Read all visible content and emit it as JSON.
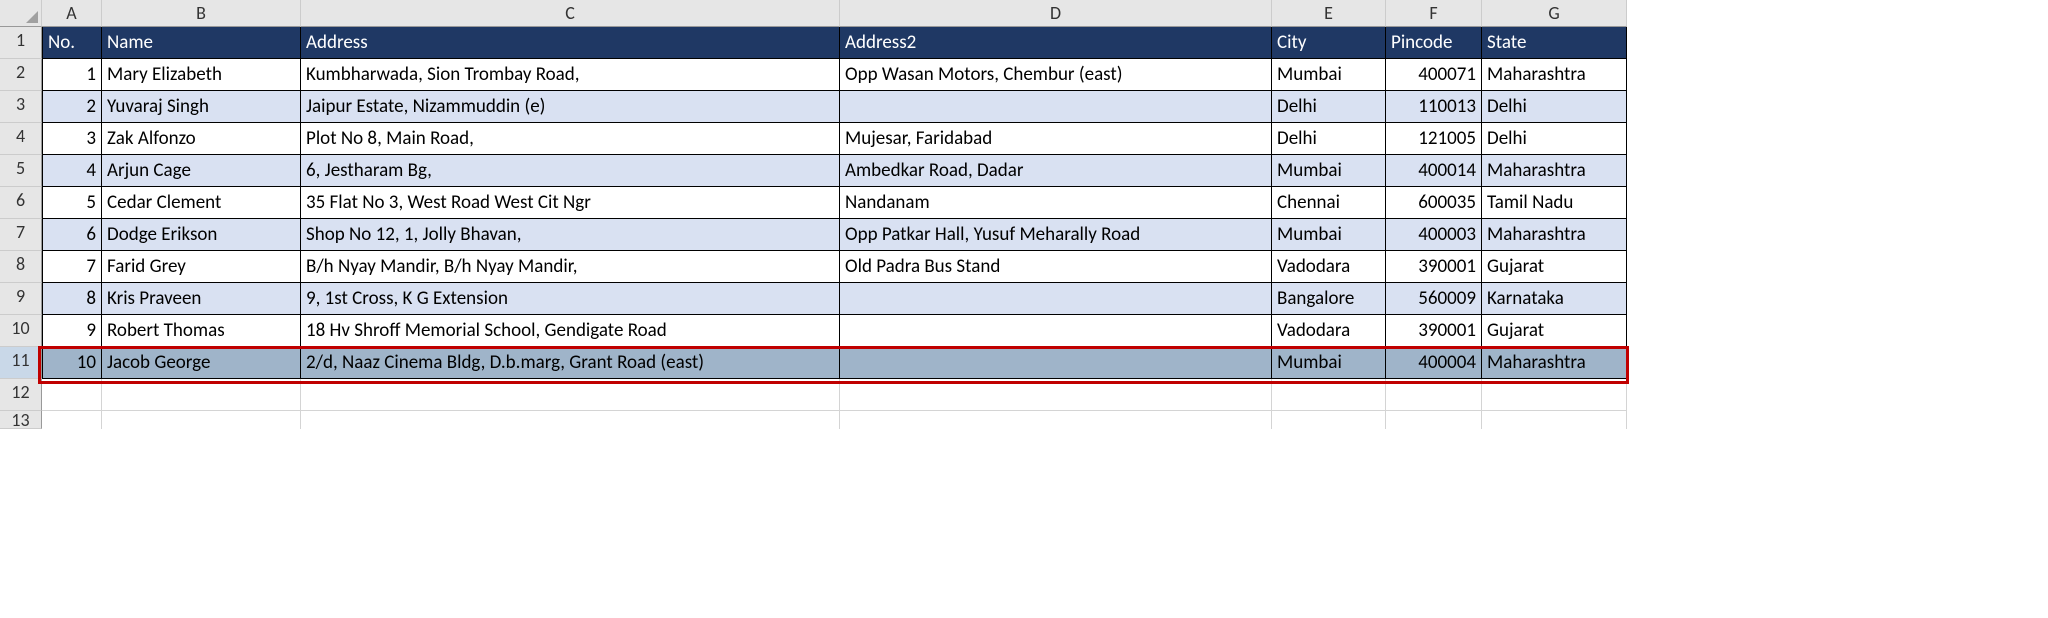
{
  "columns": [
    "A",
    "B",
    "C",
    "D",
    "E",
    "F",
    "G"
  ],
  "headers": {
    "A": "No.",
    "B": "Name",
    "C": "Address",
    "D": "Address2",
    "E": "City",
    "F": "Pincode",
    "G": "State"
  },
  "rows": [
    {
      "no": 1,
      "name": "Mary Elizabeth",
      "addr": "Kumbharwada, Sion Trombay Road,",
      "addr2": "Opp Wasan Motors, Chembur (east)",
      "city": "Mumbai",
      "pin": 400071,
      "state": "Maharashtra"
    },
    {
      "no": 2,
      "name": "Yuvaraj Singh",
      "addr": "Jaipur Estate, Nizammuddin (e)",
      "addr2": "",
      "city": "Delhi",
      "pin": 110013,
      "state": "Delhi"
    },
    {
      "no": 3,
      "name": "Zak Alfonzo",
      "addr": "Plot No 8, Main Road,",
      "addr2": "Mujesar, Faridabad",
      "city": "Delhi",
      "pin": 121005,
      "state": "Delhi"
    },
    {
      "no": 4,
      "name": "Arjun Cage",
      "addr": "6, Jestharam Bg,",
      "addr2": "Ambedkar Road, Dadar",
      "city": "Mumbai",
      "pin": 400014,
      "state": "Maharashtra"
    },
    {
      "no": 5,
      "name": "Cedar Clement",
      "addr": "35 Flat No 3, West Road West Cit Ngr",
      "addr2": "Nandanam",
      "city": "Chennai",
      "pin": 600035,
      "state": "Tamil Nadu"
    },
    {
      "no": 6,
      "name": "Dodge Erikson",
      "addr": "Shop No 12, 1, Jolly Bhavan,",
      "addr2": "Opp Patkar Hall, Yusuf Meharally Road",
      "city": "Mumbai",
      "pin": 400003,
      "state": "Maharashtra"
    },
    {
      "no": 7,
      "name": "Farid Grey",
      "addr": "B/h Nyay Mandir, B/h Nyay Mandir,",
      "addr2": "Old Padra Bus Stand",
      "city": "Vadodara",
      "pin": 390001,
      "state": "Gujarat"
    },
    {
      "no": 8,
      "name": "Kris Praveen",
      "addr": "9, 1st Cross, K G Extension",
      "addr2": "",
      "city": "Bangalore",
      "pin": 560009,
      "state": "Karnataka"
    },
    {
      "no": 9,
      "name": "Robert Thomas",
      "addr": "18 Hv Shroff Memorial School, Gendigate Road",
      "addr2": "",
      "city": "Vadodara",
      "pin": 390001,
      "state": "Gujarat"
    },
    {
      "no": 10,
      "name": "Jacob George",
      "addr": "2/d, Naaz Cinema Bldg, D.b.marg, Grant Road (east)",
      "addr2": "",
      "city": "Mumbai",
      "pin": 400004,
      "state": "Maharashtra"
    }
  ],
  "visible_row_numbers": [
    1,
    2,
    3,
    4,
    5,
    6,
    7,
    8,
    9,
    10,
    11,
    12,
    13
  ],
  "selected_row_index": 9,
  "highlight_row_index": 9
}
